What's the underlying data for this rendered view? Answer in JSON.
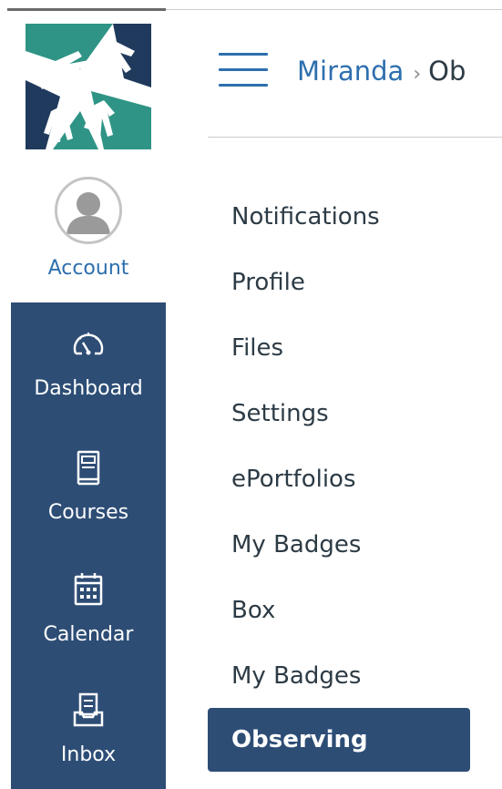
{
  "global_nav": {
    "account_label": "Account",
    "items": [
      {
        "label": "Dashboard",
        "icon": "dashboard-icon"
      },
      {
        "label": "Courses",
        "icon": "courses-icon"
      },
      {
        "label": "Calendar",
        "icon": "calendar-icon"
      },
      {
        "label": "Inbox",
        "icon": "inbox-icon"
      }
    ],
    "colors": {
      "nav_background": "#2d4d75",
      "account_label": "#2d6fae",
      "logo_teal": "#2f9486",
      "logo_navy": "#1f3a5c"
    }
  },
  "header": {
    "menu_icon": "hamburger-icon",
    "breadcrumb": {
      "link": "Miranda",
      "separator": "›",
      "current": "Ob"
    }
  },
  "section_nav": {
    "items": [
      {
        "label": "Notifications",
        "active": false
      },
      {
        "label": "Profile",
        "active": false
      },
      {
        "label": "Files",
        "active": false
      },
      {
        "label": "Settings",
        "active": false
      },
      {
        "label": "ePortfolios",
        "active": false
      },
      {
        "label": "My Badges",
        "active": false
      },
      {
        "label": "Box",
        "active": false
      },
      {
        "label": "My Badges",
        "active": false
      },
      {
        "label": "Observing",
        "active": true
      }
    ]
  }
}
